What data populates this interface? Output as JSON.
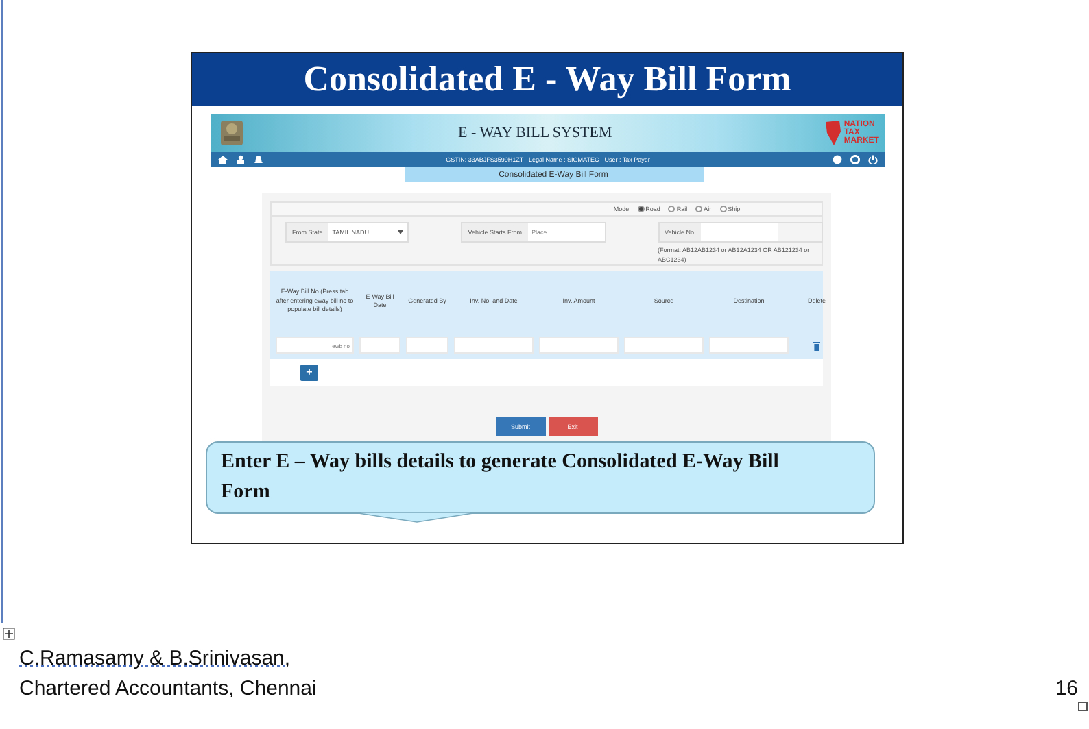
{
  "slide": {
    "title": "Consolidated E - Way Bill Form"
  },
  "app": {
    "title": "E - WAY BILL SYSTEM",
    "logo": [
      "NATION",
      "TAX",
      "MARKET"
    ],
    "user_info": "GSTIN: 33ABJFS3599H1ZT - Legal Name : SIGMATEC - User : Tax Payer",
    "page_title": "Consolidated E-Way Bill Form",
    "mode": {
      "label": "Mode",
      "options": [
        {
          "label": "Road",
          "selected": true
        },
        {
          "label": "Rail",
          "selected": false
        },
        {
          "label": "Air",
          "selected": false
        },
        {
          "label": "Ship",
          "selected": false
        }
      ]
    },
    "fields": [
      {
        "kind": "select",
        "label": "From State",
        "value": "TAMIL NADU"
      },
      {
        "kind": "input",
        "label": "Vehicle Starts From",
        "placeholder": "Place"
      },
      {
        "kind": "input",
        "label": "Vehicle No.",
        "hint": "(Format: AB12AB1234 or AB12A1234 OR AB121234 or ABC1234)"
      }
    ],
    "table": {
      "columns": [
        "E-Way Bill No (Press tab after entering eway bill no to populate bill details)",
        "E-Way Bill Date",
        "Generated By",
        "Inv. No. and Date",
        "Inv. Amount",
        "Source",
        "Destination",
        "Delete"
      ],
      "rows": [
        [
          {
            "kind": "input",
            "placeholder": "ewb no"
          },
          {
            "kind": "input"
          },
          {
            "kind": "input"
          },
          {
            "kind": "input"
          },
          {
            "kind": "input"
          },
          {
            "kind": "input"
          },
          {
            "kind": "input"
          },
          {
            "kind": "delete"
          }
        ]
      ]
    },
    "add_button": "+",
    "buttons": [
      {
        "kind": "primary",
        "label": "Submit"
      },
      {
        "kind": "danger",
        "label": "Exit"
      }
    ]
  },
  "callout": "Enter E – Way bills details to generate Consolidated E-Way Bill Form",
  "footer": {
    "authors": "C.Ramasamy & B.Srinivasan,",
    "firm": "Chartered Accountants, Chennai",
    "page_number": "16"
  }
}
